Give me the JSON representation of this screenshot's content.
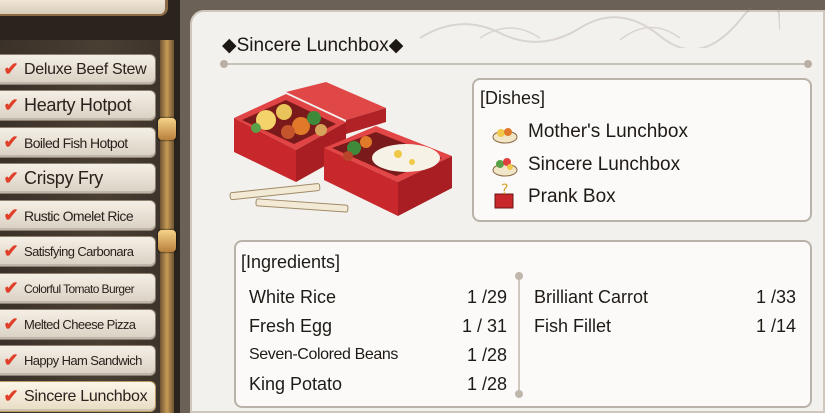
{
  "menu": {
    "items": [
      {
        "label": "Deluxe Beef Stew",
        "checked": true
      },
      {
        "label": "Hearty Hotpot",
        "checked": true
      },
      {
        "label": "Boiled Fish Hotpot",
        "checked": true
      },
      {
        "label": "Crispy Fry",
        "checked": true
      },
      {
        "label": "Rustic Omelet Rice",
        "checked": true
      },
      {
        "label": "Satisfying Carbonara",
        "checked": true
      },
      {
        "label": "Colorful Tomato Burger",
        "checked": true
      },
      {
        "label": "Melted Cheese Pizza",
        "checked": true
      },
      {
        "label": "Happy Ham Sandwich",
        "checked": true
      },
      {
        "label": "Sincere Lunchbox",
        "checked": true,
        "selected": true
      }
    ],
    "check_glyph": "✔"
  },
  "recipe": {
    "title": "◆Sincere Lunchbox◆"
  },
  "dishes": {
    "header": "[Dishes]",
    "items": [
      {
        "label": "Mother's Lunchbox",
        "icon": "lunchbox-icon"
      },
      {
        "label": "Sincere Lunchbox",
        "icon": "salad-icon"
      },
      {
        "label": "Prank Box",
        "icon": "prank-box-icon"
      }
    ]
  },
  "ingredients": {
    "header": "[Ingredients]",
    "left": [
      {
        "name": "White Rice",
        "count": "1 /29"
      },
      {
        "name": "Fresh Egg",
        "count": "1 / 31"
      },
      {
        "name": "Seven-Colored Beans",
        "count": "1 /28"
      },
      {
        "name": "King Potato",
        "count": "1 /28"
      }
    ],
    "right": [
      {
        "name": "Brilliant Carrot",
        "count": "1 /33"
      },
      {
        "name": "Fish Fillet",
        "count": "1 /14"
      }
    ]
  },
  "colors": {
    "check": "#e0402a",
    "lunchbox_red": "#c8282c",
    "panel_bg": "#f3f1ee"
  }
}
